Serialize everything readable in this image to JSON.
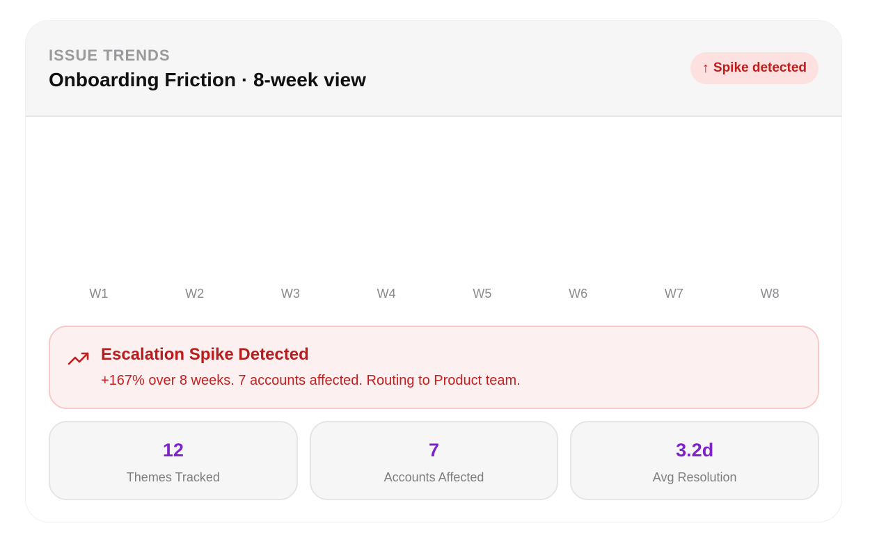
{
  "header": {
    "eyebrow": "ISSUE TRENDS",
    "title": "Onboarding Friction · 8-week view",
    "badge_arrow": "↑",
    "badge_label": "Spike detected"
  },
  "chart": {
    "weeks": [
      "W1",
      "W2",
      "W3",
      "W4",
      "W5",
      "W6",
      "W7",
      "W8"
    ]
  },
  "alert": {
    "icon": "trending-up-icon",
    "title": "Escalation Spike Detected",
    "message": "+167% over 8 weeks. 7 accounts affected. Routing to Product team."
  },
  "stats": [
    {
      "value": "12",
      "label": "Themes Tracked"
    },
    {
      "value": "7",
      "label": "Accounts Affected"
    },
    {
      "value": "3.2d",
      "label": "Avg Resolution"
    }
  ],
  "colors": {
    "accent_purple": "#7e22ce",
    "alert_red": "#b91c1c",
    "badge_bg": "#fde1e1",
    "alert_bg": "#fdf0f0"
  }
}
